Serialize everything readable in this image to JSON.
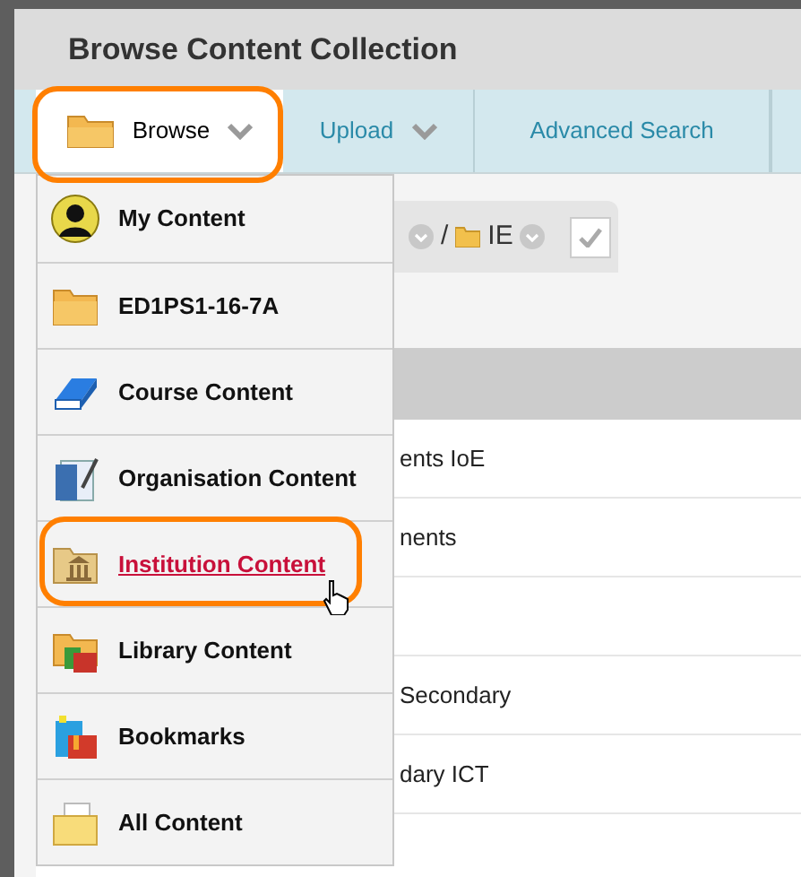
{
  "dialog": {
    "title": "Browse Content Collection"
  },
  "tabs": [
    {
      "label": "Browse",
      "selected": true,
      "highlighted": true,
      "has_caret": true
    },
    {
      "label": "Upload",
      "selected": false,
      "highlighted": false,
      "has_caret": true
    },
    {
      "label": "Advanced Search",
      "selected": false,
      "highlighted": false,
      "has_caret": false
    }
  ],
  "breadcrumb": {
    "separator": "/",
    "folder": "IE"
  },
  "rows": [
    {
      "text": "ents IoE"
    },
    {
      "text": "nents"
    },
    {
      "text": ""
    },
    {
      "text": "Secondary"
    },
    {
      "text": "dary ICT"
    }
  ],
  "menu": {
    "items": [
      {
        "label": "My Content",
        "selected": false,
        "highlighted": false
      },
      {
        "label": "ED1PS1-16-7A",
        "selected": false,
        "highlighted": false
      },
      {
        "label": "Course Content",
        "selected": false,
        "highlighted": false
      },
      {
        "label": "Organisation Content",
        "selected": false,
        "highlighted": false
      },
      {
        "label": "Institution Content",
        "selected": true,
        "highlighted": true
      },
      {
        "label": "Library Content",
        "selected": false,
        "highlighted": false
      },
      {
        "label": "Bookmarks",
        "selected": false,
        "highlighted": false
      },
      {
        "label": "All Content",
        "selected": false,
        "highlighted": false
      }
    ]
  }
}
